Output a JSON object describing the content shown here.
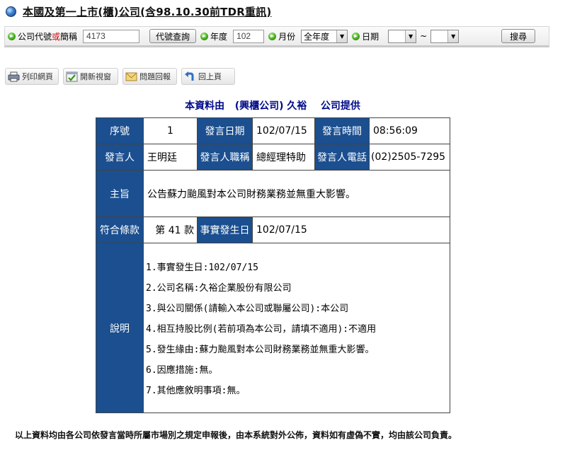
{
  "page": {
    "title": "本國及第一上市(櫃)公司(含98.10.30前TDR重訊)"
  },
  "search": {
    "company_label_prefix": "公司代號",
    "company_label_or": "或",
    "company_label_suffix": "簡稱",
    "company_value": "4173",
    "lookup_button": "代號查詢",
    "year_label": "年度",
    "year_value": "102",
    "month_label": "月份",
    "month_value": "全年度",
    "date_label": "日期",
    "date_from": "",
    "date_sep": "~",
    "date_to": "",
    "search_button": "搜尋"
  },
  "toolbar": {
    "print": "列印網頁",
    "new_window": "開新視窗",
    "report": "問題回報",
    "back": "回上頁"
  },
  "provider": {
    "prefix": "本資料由",
    "market": "(興櫃公司)",
    "company": "久裕",
    "suffix": "公司提供"
  },
  "record": {
    "seq_label": "序號",
    "seq_value": "1",
    "date_label": "發言日期",
    "date_value": "102/07/15",
    "time_label": "發言時間",
    "time_value": "08:56:09",
    "speaker_label": "發言人",
    "speaker_value": "王明廷",
    "title_label": "發言人職稱",
    "title_value": "總經理特助",
    "phone_label": "發言人電話",
    "phone_value": "(02)2505-7295",
    "subject_label": "主旨",
    "subject_value": "公告蘇力颱風對本公司財務業務並無重大影響。",
    "clause_label": "符合條款",
    "clause_value": "第 41 款",
    "event_date_label": "事實發生日",
    "event_date_value": "102/07/15",
    "desc_label": "說明",
    "desc_lines": [
      "1.事實發生日:102/07/15",
      "2.公司名稱:久裕企業股份有限公司",
      "3.與公司關係(請輸入本公司或聯屬公司):本公司",
      "4.相互持股比例(若前項為本公司，請填不適用):不適用",
      "5.發生緣由:蘇力颱風對本公司財務業務並無重大影響。",
      "6.因應措施:無。",
      "7.其他應敘明事項:無。"
    ]
  },
  "footer": {
    "disclaimer": "以上資料均由各公司依發言當時所屬市場別之規定申報後，由本系統對外公佈，資料如有虛偽不實，均由該公司負責。"
  },
  "colors": {
    "header_cell": "#1b4f8f",
    "provider_text": "#000a88",
    "accent_red": "#d00000"
  }
}
